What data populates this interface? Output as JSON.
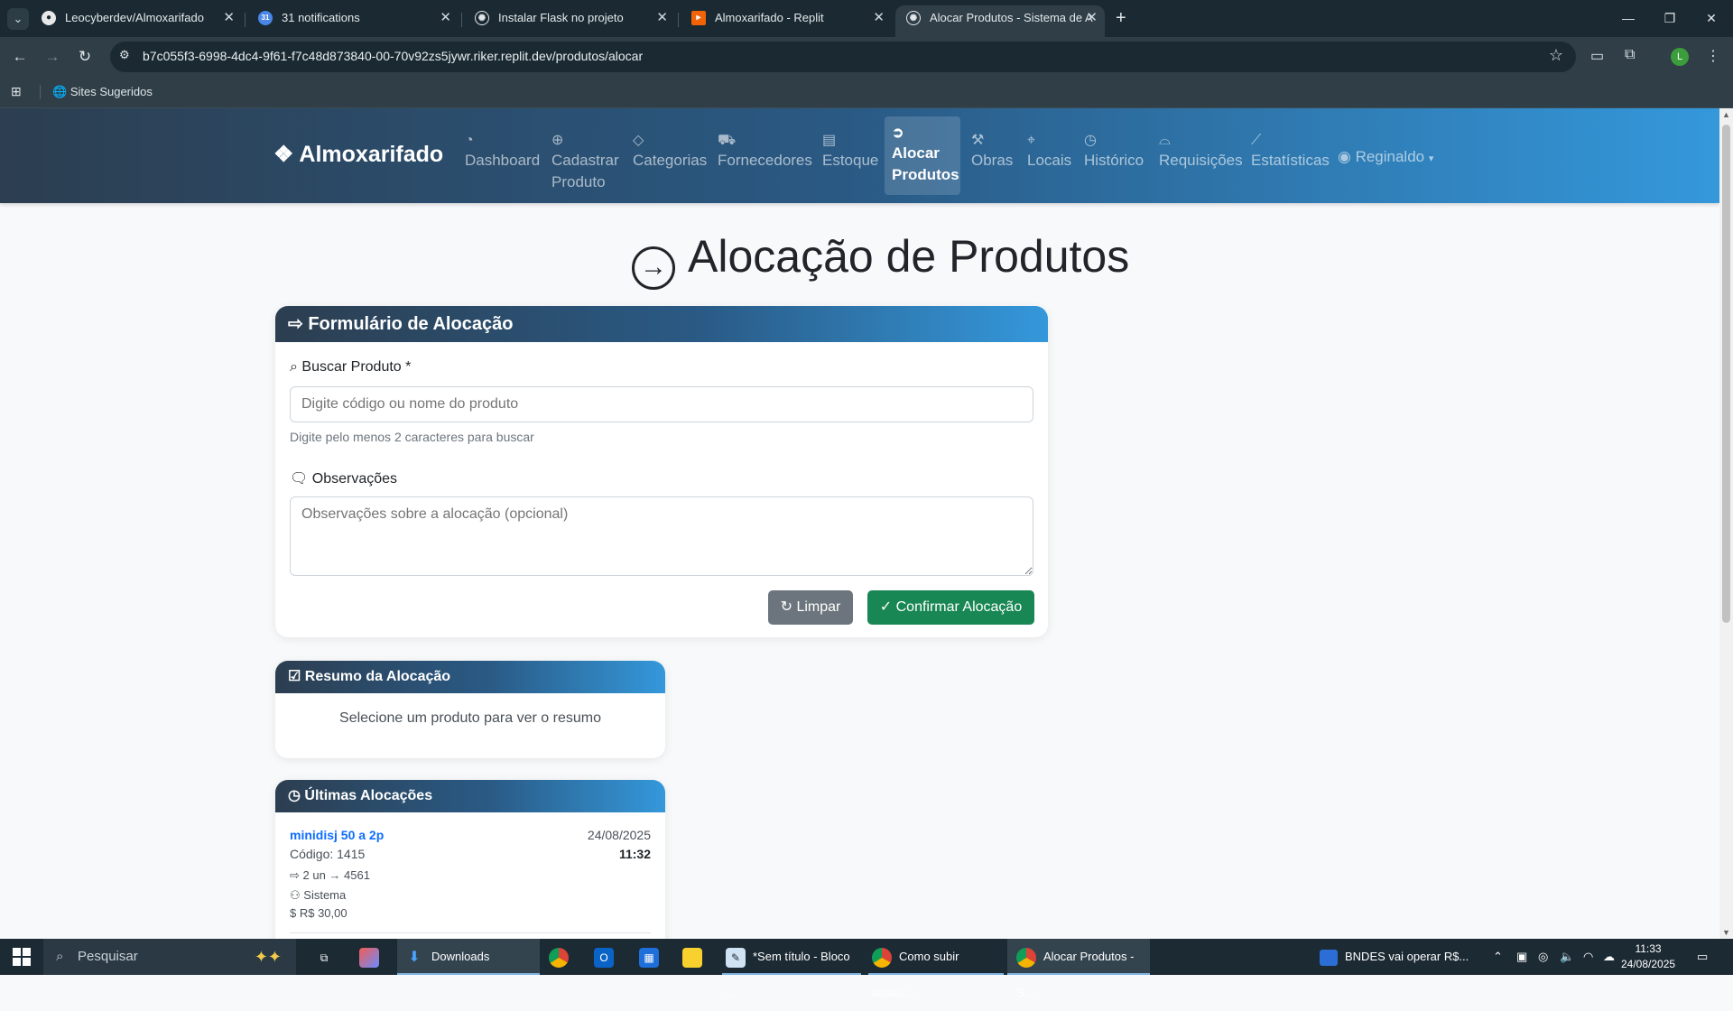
{
  "browser": {
    "tabs": [
      {
        "title": "Leocyberdev/Almoxarifado",
        "icon": "github-icon"
      },
      {
        "title": "31 notifications",
        "icon": "calendar-icon",
        "badge": "31"
      },
      {
        "title": "Instalar Flask no projeto",
        "icon": "chatgpt-icon"
      },
      {
        "title": "Almoxarifado - Replit",
        "icon": "replit-icon"
      },
      {
        "title": "Alocar Produtos - Sistema de A",
        "icon": "chatgpt-icon"
      }
    ],
    "active_tab": 4,
    "url": "b7c055f3-6998-4dc4-9f61-f7c48d873840-00-70v92zs5jywr.riker.replit.dev/produtos/alocar",
    "bookmark": "Sites Sugeridos",
    "profile_initial": "L"
  },
  "nav": {
    "brand": "Almoxarifado",
    "items": [
      {
        "label": "Dashboard",
        "icon": "speedometer-icon"
      },
      {
        "label": "Cadastrar\nProduto",
        "icon": "plus-circle-icon"
      },
      {
        "label": "Categorias",
        "icon": "tags-icon"
      },
      {
        "label": "Fornecedores",
        "icon": "truck-icon"
      },
      {
        "label": "Estoque",
        "icon": "archive-icon"
      },
      {
        "label": "Alocar\nProdutos",
        "icon": "arrow-right-circle-icon",
        "active": true
      },
      {
        "label": "Obras",
        "icon": "hammer-icon"
      },
      {
        "label": "Locais",
        "icon": "geo-alt-icon"
      },
      {
        "label": "Histórico",
        "icon": "clock-icon"
      },
      {
        "label": "Requisições",
        "icon": "inbox-icon"
      },
      {
        "label": "Estatísticas",
        "icon": "graph-up-icon"
      }
    ],
    "user": "Reginaldo"
  },
  "page": {
    "title": "Alocação de Produtos",
    "form": {
      "header": "Formulário de Alocação",
      "search_label": "Buscar Produto *",
      "search_placeholder": "Digite código ou nome do produto",
      "search_help": "Digite pelo menos 2 caracteres para buscar",
      "obs_label": "Observações",
      "obs_placeholder": "Observações sobre a alocação (opcional)",
      "clear_button": "Limpar",
      "confirm_button": "Confirmar Alocação"
    },
    "summary": {
      "header": "Resumo da Alocação",
      "empty": "Selecione um produto para ver o resumo"
    },
    "recent": {
      "header": "Últimas Alocações",
      "items": [
        {
          "name": "minidisj 50 a 2p",
          "code": "Código: 1415",
          "qty": "2 un → 4561",
          "user": "Sistema",
          "value": "R$ 30,00",
          "date": "24/08/2025",
          "time": "11:32"
        }
      ]
    }
  },
  "colors": {
    "nav_start": "#2c3e50",
    "nav_end": "#3498db",
    "success": "#198754",
    "secondary": "#6c757d",
    "link": "#0d6efd"
  },
  "taskbar": {
    "search": "Pesquisar",
    "apps": [
      {
        "label": "Downloads"
      },
      {
        "label": "*Sem título - Bloco ..."
      },
      {
        "label": "Como subir atualiz..."
      },
      {
        "label": "Alocar Produtos - S..."
      }
    ],
    "news": "BNDES vai operar R$...",
    "time": "11:33",
    "date": "24/08/2025"
  }
}
